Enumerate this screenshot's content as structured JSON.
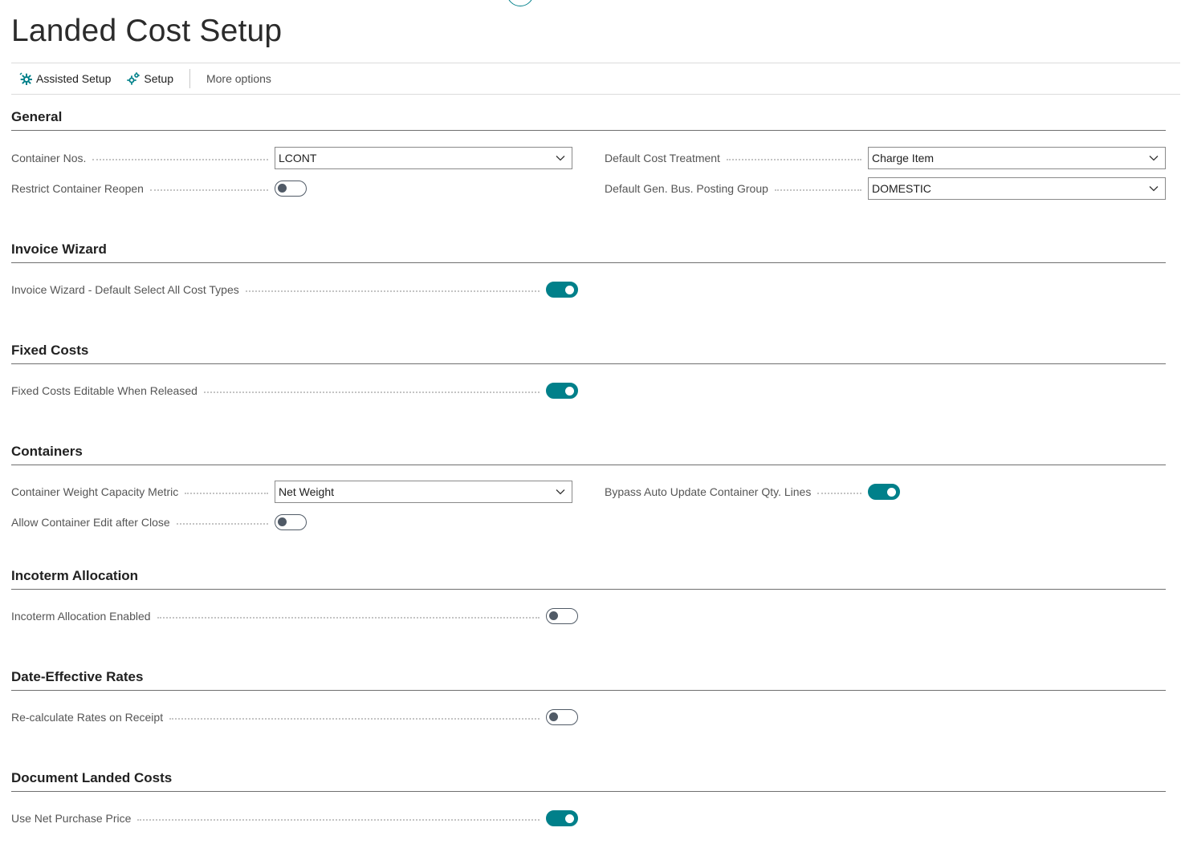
{
  "page": {
    "title": "Landed Cost Setup"
  },
  "actions": {
    "assisted_setup": "Assisted Setup",
    "setup": "Setup",
    "more_options": "More options"
  },
  "colors": {
    "accent": "#00808a",
    "toggle_off": "#505a66"
  },
  "sections": {
    "general": {
      "title": "General",
      "container_nos": {
        "label": "Container Nos.",
        "value": "LCONT"
      },
      "restrict_container_reopen": {
        "label": "Restrict Container Reopen",
        "value": false
      },
      "default_cost_treatment": {
        "label": "Default Cost Treatment",
        "value": "Charge Item"
      },
      "default_gen_bus_posting_group": {
        "label": "Default Gen. Bus. Posting Group",
        "value": "DOMESTIC"
      }
    },
    "invoice_wizard": {
      "title": "Invoice Wizard",
      "default_select_all": {
        "label": "Invoice Wizard - Default Select All Cost Types",
        "value": true
      }
    },
    "fixed_costs": {
      "title": "Fixed Costs",
      "editable_when_released": {
        "label": "Fixed Costs Editable When Released",
        "value": true
      }
    },
    "containers": {
      "title": "Containers",
      "weight_capacity_metric": {
        "label": "Container Weight Capacity Metric",
        "value": "Net Weight"
      },
      "allow_edit_after_close": {
        "label": "Allow Container Edit after Close",
        "value": false
      },
      "bypass_auto_update": {
        "label": "Bypass Auto Update Container Qty. Lines",
        "value": true
      }
    },
    "incoterm_allocation": {
      "title": "Incoterm Allocation",
      "enabled": {
        "label": "Incoterm Allocation Enabled",
        "value": false
      }
    },
    "date_effective_rates": {
      "title": "Date-Effective Rates",
      "recalculate_on_receipt": {
        "label": "Re-calculate Rates on Receipt",
        "value": false
      }
    },
    "document_landed_costs": {
      "title": "Document Landed Costs",
      "use_net_purchase_price": {
        "label": "Use Net Purchase Price",
        "value": true
      }
    }
  }
}
